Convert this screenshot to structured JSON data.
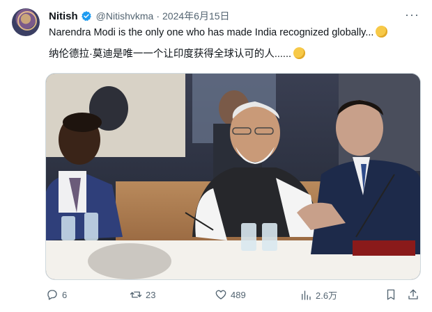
{
  "post": {
    "author_name": "Nitish",
    "handle": "@Nitishvkma",
    "separator": "·",
    "date": "2024年6月15日",
    "more_glyph": "···",
    "text_en": "Narendra Modi is the only one who has made India recognized globally...",
    "text_zh": "纳伦德拉·莫迪是唯一一个让印度获得全球认可的人......"
  },
  "actions": {
    "replies": "6",
    "reposts": "23",
    "likes": "489",
    "views": "2.6万"
  },
  "colors": {
    "verified": "#1d9bf0",
    "muted_text": "#536471"
  },
  "icons": [
    "verified-badge-icon",
    "more-icon",
    "raised-fist-emoji-icon",
    "reply-icon",
    "repost-icon",
    "like-icon",
    "views-icon",
    "bookmark-icon",
    "share-icon"
  ]
}
